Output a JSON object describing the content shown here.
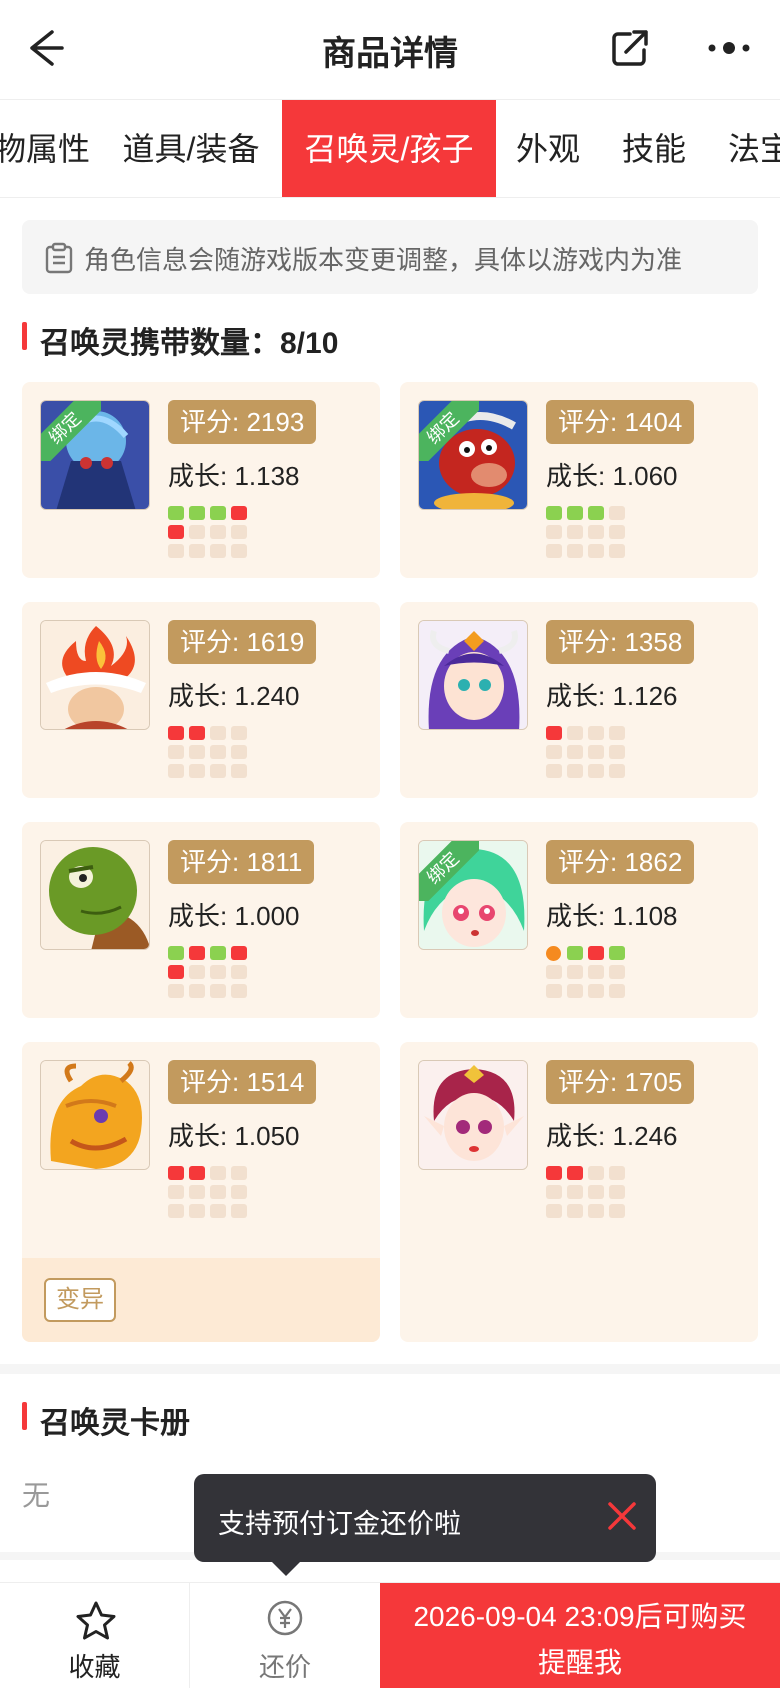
{
  "header": {
    "title": "商品详情",
    "back_icon": "arrow-left-icon",
    "share_icon": "share-icon",
    "more_icon": "more-dots-icon"
  },
  "tabs": [
    {
      "label": "物属性",
      "active": false
    },
    {
      "label": "道具/装备",
      "active": false
    },
    {
      "label": "召唤灵/孩子",
      "active": true
    },
    {
      "label": "外观",
      "active": false
    },
    {
      "label": "技能",
      "active": false
    },
    {
      "label": "法宝",
      "active": false
    }
  ],
  "notice": {
    "icon": "clipboard-icon",
    "text": "角色信息会随游戏版本变更调整，具体以游戏内为准"
  },
  "summons": {
    "title": "召唤灵携带数量：8/10",
    "bind_label": "绑定",
    "cards": [
      {
        "score": "评分: 2193",
        "growth": "成长: 1.138",
        "bound": true,
        "dots": [
          "g",
          "g",
          "g",
          "r",
          "r"
        ]
      },
      {
        "score": "评分: 1404",
        "growth": "成长: 1.060",
        "bound": true,
        "dots": [
          "g",
          "g",
          "g"
        ]
      },
      {
        "score": "评分: 1619",
        "growth": "成长: 1.240",
        "bound": false,
        "dots": [
          "r",
          "r"
        ]
      },
      {
        "score": "评分: 1358",
        "growth": "成长: 1.126",
        "bound": false,
        "dots": [
          "r"
        ]
      },
      {
        "score": "评分: 1811",
        "growth": "成长: 1.000",
        "bound": false,
        "dots": [
          "g",
          "r",
          "g",
          "r",
          "r"
        ]
      },
      {
        "score": "评分: 1862",
        "growth": "成长: 1.108",
        "bound": true,
        "dots": [
          "o",
          "g",
          "r",
          "g"
        ]
      },
      {
        "score": "评分: 1514",
        "growth": "成长: 1.050",
        "bound": false,
        "dots": [
          "r",
          "r"
        ],
        "tag": "变异"
      },
      {
        "score": "评分: 1705",
        "growth": "成长: 1.246",
        "bound": false,
        "dots": [
          "r",
          "r"
        ]
      }
    ]
  },
  "card_album": {
    "title": "召唤灵卡册",
    "value": "无"
  },
  "toast": {
    "text": "支持预付订金还价啦",
    "close_icon": "close-icon"
  },
  "bottom_bar": {
    "favorite": {
      "label": "收藏",
      "icon": "star-icon"
    },
    "bargain": {
      "label": "还价",
      "icon": "yen-coin-icon"
    },
    "buy_line1": "2026-09-04 23:09后可购买",
    "buy_line2": "提醒我"
  },
  "colors": {
    "accent": "#f5383a",
    "card_bg": "#fdf4ea",
    "score_bg": "#c29a5e",
    "dot_green": "#8bd150",
    "dot_red": "#f5383a",
    "dot_orange": "#f58a1f"
  }
}
